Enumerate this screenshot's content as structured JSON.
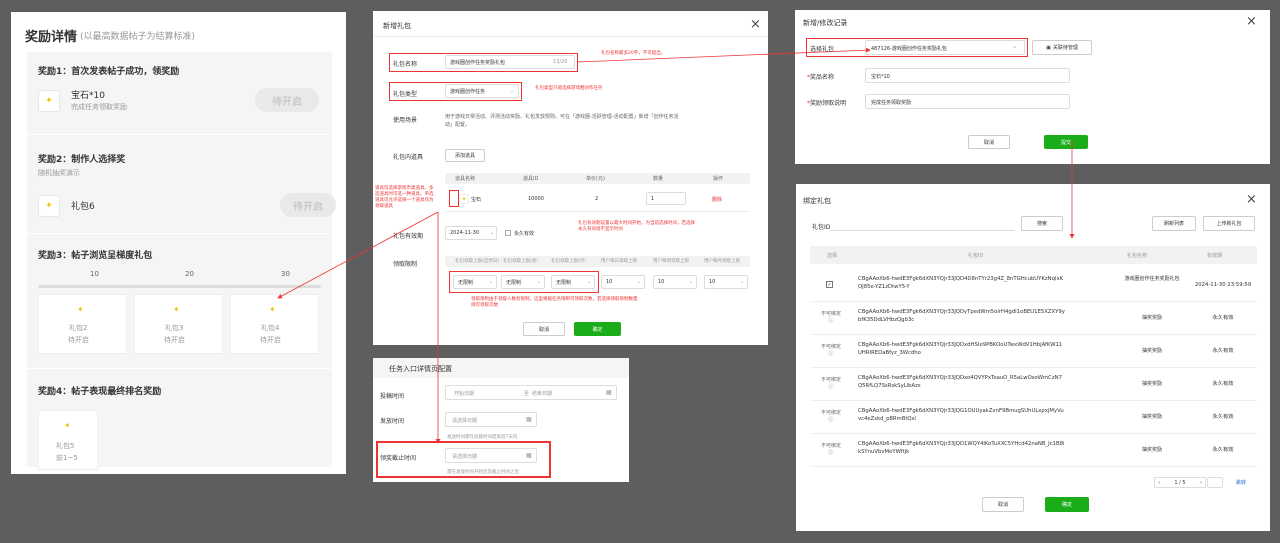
{
  "reward": {
    "title": "奖励详情",
    "subtitle": "(以最高数据帖子为结算标准)",
    "r1": {
      "title": "奖励1：首次发表帖子成功，领奖励",
      "item": "宝石*10",
      "desc": "完成任务领取奖励",
      "btn": "待开启"
    },
    "r2": {
      "title": "奖励2：制作人选择奖",
      "desc": "随机抽奖演示",
      "item": "礼包6",
      "btn": "待开启"
    },
    "r3": {
      "title": "奖励3：帖子浏览呈梯度礼包",
      "ticks": [
        "10",
        "20",
        "30"
      ],
      "cards": [
        {
          "name": "礼包2",
          "status": "待开启"
        },
        {
          "name": "礼包3",
          "status": "待开启"
        },
        {
          "name": "礼包4",
          "status": "待开启"
        }
      ]
    },
    "r4": {
      "title": "奖励4：帖子表现最终排名奖励",
      "card": {
        "name": "礼包5",
        "rank": "前1~5"
      }
    }
  },
  "gift": {
    "title": "新增礼包",
    "name_label": "礼包名称",
    "name_value": "游戏圈创作任务奖励礼包",
    "name_count": "13/20",
    "type_label": "礼包类型",
    "type_value": "游戏圈创作任务",
    "usage_label": "使用场景",
    "usage_text": "用于游戏日常活动、评测活动奖励、礼包发放规则。可在「游戏圈-活跃管理-活动配置」新增「创作任务活动」配置。",
    "props_label": "礼包内道具",
    "add_prop": "添加道具",
    "table_head": [
      "道具名称",
      "道具ID",
      "单价(元)",
      "数量",
      "操作"
    ],
    "row": {
      "name": "宝石",
      "id": "10000",
      "price": "2",
      "qty": "1",
      "op": "删除"
    },
    "valid_label": "礼包有效期",
    "valid_date": "2024-11-30",
    "forever": "永久有效",
    "recv_label": "领取限制",
    "recv_head": [
      "礼包领取上限(自然日)",
      "礼包领取上限(周)",
      "礼包领取上限(月)",
      "用户每日领取上限",
      "用户每周领取上限",
      "用户每月领取上限"
    ],
    "recv_sel": "无限制",
    "recv_nums": [
      "10",
      "10",
      "10"
    ],
    "cancel": "取消",
    "ok": "确定",
    "notes": {
      "n1": "礼包名称最多20字，不可超出。",
      "n2": "礼包类型只能选择游戏圈创作任务",
      "n3": "道具仅选择游戏币类道具、多选道具时可选一种道具，单选道具仅允许选择一个道具作为领取道具",
      "n4": "礼包有效期设置以最大时间开始，为当前选择时间，若选择永久有效则不显示时间",
      "n5": "领取限制由于领取人数有限制，这里根据任务限制可领取次数，若选择领取限制数量则可领取次数"
    }
  },
  "task": {
    "title": "任务入口详情页配置",
    "submit_label": "投稿时间",
    "start_ph": "开始日期",
    "to": "至",
    "end_ph": "结束日期",
    "publish_label": "发放时间",
    "date_ph": "请选择日期",
    "publish_hint": "发放时间需在投稿时间结束后7天内",
    "deadline_label": "领奖截止时间",
    "deadline_hint": "需在发放时间开始后及截止时间之后"
  },
  "record": {
    "title": "新增/修改记录",
    "select_label": "选择礼包",
    "select_value": "487126-游戏圈创作任务奖励礼包",
    "bind_btn": "关联待管理",
    "name_label": "奖品名称",
    "name_value": "宝石*10",
    "desc_label": "奖励领取说明",
    "desc_value": "完成任务领取奖励",
    "cancel": "取消",
    "submit": "提交"
  },
  "bind": {
    "title": "绑定礼包",
    "id_label": "礼包ID",
    "search": "搜索",
    "refresh": "刷新列表",
    "upload": "上传新礼包",
    "head": [
      "选择",
      "礼包ID",
      "礼包名称",
      "有效期"
    ],
    "rows": [
      {
        "sel": "✓",
        "id": "CBgAAoXb6-hwdE3Fgk6dXN3YQjr33JQD4D8nTYr23g4Z_8nTGHcubUYKzNqlxKOJ85e-YZ1zDtwY5-Y",
        "name": "游戏圈创作任务奖励礼包",
        "valid": "2024-11-30 23:59:59"
      },
      {
        "sel": "不可绑定",
        "id": "CBgAAoXb6-hwdE3Fgk6dXN3YQjr33JQDyTpedWm5oirH4gdI1oBEU1E5XZXY9ybfK35DdLVHbzQgb3c",
        "name": "抽奖奖励",
        "valid": "永久有效"
      },
      {
        "sel": "不可绑定",
        "id": "CBgAAoXb6-hwdE3Fgk6dXN3YQjr33JQDxdHSIe9PBKOoUTwxWdV1HbjAfKW11UHRIREDaBfyz_3Wcdho",
        "name": "抽奖奖励",
        "valid": "永久有效"
      },
      {
        "sel": "不可绑定",
        "id": "CBgAAoXb6-hwdE3Fgk6dXN3YQjr33JQDxo4QVYPxToauO_R5aLwOsoWmCzN7Q5RfLQ7SsRskSyLlbAzs",
        "name": "抽奖奖励",
        "valid": "永久有效"
      },
      {
        "sel": "不可绑定",
        "id": "CBgAAoXb6-hwdE3Fgk6dXN3YQjr33JQG1OUUyakZxnF9BmugSUhULxpxjMyVuvc4eZskd_p8RmBtQsl",
        "name": "抽奖奖励",
        "valid": "永久有效"
      },
      {
        "sel": "不可绑定",
        "id": "CBgAAoXb6-hwdE3Fgk6dXN3YQjr33JQD1WQY4lKoTuXXC5YHcd42naNB_Jc1B8ikSYnuVbvMeYWftjk",
        "name": "抽奖奖励",
        "valid": "永久有效"
      }
    ],
    "page": "1 / 5",
    "goto": "跳转",
    "cancel": "取消",
    "ok": "确定"
  },
  "colors": {
    "green": "#1aad19",
    "red": "#e33333",
    "bg": "#5e5e5e"
  }
}
